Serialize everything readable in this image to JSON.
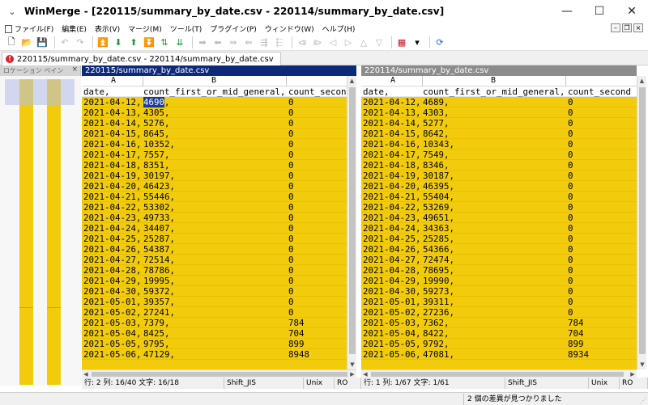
{
  "window": {
    "title": "WinMerge - [220115/summary_by_date.csv - 220114/summary_by_date.csv]",
    "sysmenu_glyph": "⌄",
    "controls": {
      "minimize": "—",
      "maximize": "☐",
      "close": "✕"
    }
  },
  "menubar": {
    "items": [
      {
        "label": "ファイル(F)"
      },
      {
        "label": "編集(E)"
      },
      {
        "label": "表示(V)"
      },
      {
        "label": "マージ(M)"
      },
      {
        "label": "ツール(T)"
      },
      {
        "label": "プラグイン(P)"
      },
      {
        "label": "ウィンドウ(W)"
      },
      {
        "label": "ヘルプ(H)"
      }
    ],
    "mdi": {
      "minimize": "–",
      "restore": "❐",
      "close": "×"
    }
  },
  "tab": {
    "label": "220115/summary_by_date.csv - 220114/summary_by_date.csv",
    "warning_glyph": "!"
  },
  "location_pane": {
    "title": "ロケーション ペイン",
    "close": "×"
  },
  "left_pane": {
    "header": "220115/summary_by_date.csv",
    "columns": {
      "a": "A",
      "b": "B"
    },
    "rows": [
      {
        "c1": "date,",
        "c2": "count_first_or_mid_general,",
        "c3": "count_second"
      },
      {
        "c1": "2021-04-12,",
        "c2": "4690,",
        "c3": "0"
      },
      {
        "c1": "2021-04-13,",
        "c2": "4305,",
        "c3": "0"
      },
      {
        "c1": "2021-04-14,",
        "c2": "5276,",
        "c3": "0"
      },
      {
        "c1": "2021-04-15,",
        "c2": "8645,",
        "c3": "0"
      },
      {
        "c1": "2021-04-16,",
        "c2": "10352,",
        "c3": "0"
      },
      {
        "c1": "2021-04-17,",
        "c2": "7557,",
        "c3": "0"
      },
      {
        "c1": "2021-04-18,",
        "c2": "8351,",
        "c3": "0"
      },
      {
        "c1": "2021-04-19,",
        "c2": "30197,",
        "c3": "0"
      },
      {
        "c1": "2021-04-20,",
        "c2": "46423,",
        "c3": "0"
      },
      {
        "c1": "2021-04-21,",
        "c2": "55446,",
        "c3": "0"
      },
      {
        "c1": "2021-04-22,",
        "c2": "53302,",
        "c3": "0"
      },
      {
        "c1": "2021-04-23,",
        "c2": "49733,",
        "c3": "0"
      },
      {
        "c1": "2021-04-24,",
        "c2": "34407,",
        "c3": "0"
      },
      {
        "c1": "2021-04-25,",
        "c2": "25287,",
        "c3": "0"
      },
      {
        "c1": "2021-04-26,",
        "c2": "54387,",
        "c3": "0"
      },
      {
        "c1": "2021-04-27,",
        "c2": "72514,",
        "c3": "0"
      },
      {
        "c1": "2021-04-28,",
        "c2": "78786,",
        "c3": "0"
      },
      {
        "c1": "2021-04-29,",
        "c2": "19995,",
        "c3": "0"
      },
      {
        "c1": "2021-04-30,",
        "c2": "59372,",
        "c3": "0"
      },
      {
        "c1": "2021-05-01,",
        "c2": "39357,",
        "c3": "0"
      },
      {
        "c1": "2021-05-02,",
        "c2": "27241,",
        "c3": "0"
      },
      {
        "c1": "2021-05-03,",
        "c2": "7379,",
        "c3": "784"
      },
      {
        "c1": "2021-05-04,",
        "c2": "8425,",
        "c3": "704"
      },
      {
        "c1": "2021-05-05,",
        "c2": "9795,",
        "c3": "899"
      },
      {
        "c1": "2021-05-06,",
        "c2": "47129,",
        "c3": "8948"
      }
    ],
    "status": {
      "position": "行: 2  列: 16/40  文字: 16/18",
      "encoding": "Shift_JIS",
      "eol": "Unix",
      "mode": "RO"
    }
  },
  "right_pane": {
    "header": "220114/summary_by_date.csv",
    "columns": {
      "a": "A",
      "b": "B"
    },
    "rows": [
      {
        "c1": "date,",
        "c2": "count_first_or_mid_general,",
        "c3": "count_second"
      },
      {
        "c1": "2021-04-12,",
        "c2": "4689,",
        "c3": "0"
      },
      {
        "c1": "2021-04-13,",
        "c2": "4303,",
        "c3": "0"
      },
      {
        "c1": "2021-04-14,",
        "c2": "5277,",
        "c3": "0"
      },
      {
        "c1": "2021-04-15,",
        "c2": "8642,",
        "c3": "0"
      },
      {
        "c1": "2021-04-16,",
        "c2": "10343,",
        "c3": "0"
      },
      {
        "c1": "2021-04-17,",
        "c2": "7549,",
        "c3": "0"
      },
      {
        "c1": "2021-04-18,",
        "c2": "8346,",
        "c3": "0"
      },
      {
        "c1": "2021-04-19,",
        "c2": "30187,",
        "c3": "0"
      },
      {
        "c1": "2021-04-20,",
        "c2": "46395,",
        "c3": "0"
      },
      {
        "c1": "2021-04-21,",
        "c2": "55404,",
        "c3": "0"
      },
      {
        "c1": "2021-04-22,",
        "c2": "53269,",
        "c3": "0"
      },
      {
        "c1": "2021-04-23,",
        "c2": "49651,",
        "c3": "0"
      },
      {
        "c1": "2021-04-24,",
        "c2": "34363,",
        "c3": "0"
      },
      {
        "c1": "2021-04-25,",
        "c2": "25285,",
        "c3": "0"
      },
      {
        "c1": "2021-04-26,",
        "c2": "54366,",
        "c3": "0"
      },
      {
        "c1": "2021-04-27,",
        "c2": "72474,",
        "c3": "0"
      },
      {
        "c1": "2021-04-28,",
        "c2": "78695,",
        "c3": "0"
      },
      {
        "c1": "2021-04-29,",
        "c2": "19990,",
        "c3": "0"
      },
      {
        "c1": "2021-04-30,",
        "c2": "59273,",
        "c3": "0"
      },
      {
        "c1": "2021-05-01,",
        "c2": "39311,",
        "c3": "0"
      },
      {
        "c1": "2021-05-02,",
        "c2": "27236,",
        "c3": "0"
      },
      {
        "c1": "2021-05-03,",
        "c2": "7362,",
        "c3": "784"
      },
      {
        "c1": "2021-05-04,",
        "c2": "8422,",
        "c3": "704"
      },
      {
        "c1": "2021-05-05,",
        "c2": "9792,",
        "c3": "899"
      },
      {
        "c1": "2021-05-06,",
        "c2": "47081,",
        "c3": "8934"
      }
    ],
    "status": {
      "position": "行: 1  列: 1/67  文字: 1/61",
      "encoding": "Shift_JIS",
      "eol": "Unix",
      "mode": "RO"
    }
  },
  "main_status": {
    "message": "2 個の差異が見つかりました"
  },
  "colors": {
    "diff": "#f2cc0c",
    "active_header": "#0d2a7a",
    "inactive_header": "#8c8c8c",
    "selection": "#1c3d96"
  }
}
